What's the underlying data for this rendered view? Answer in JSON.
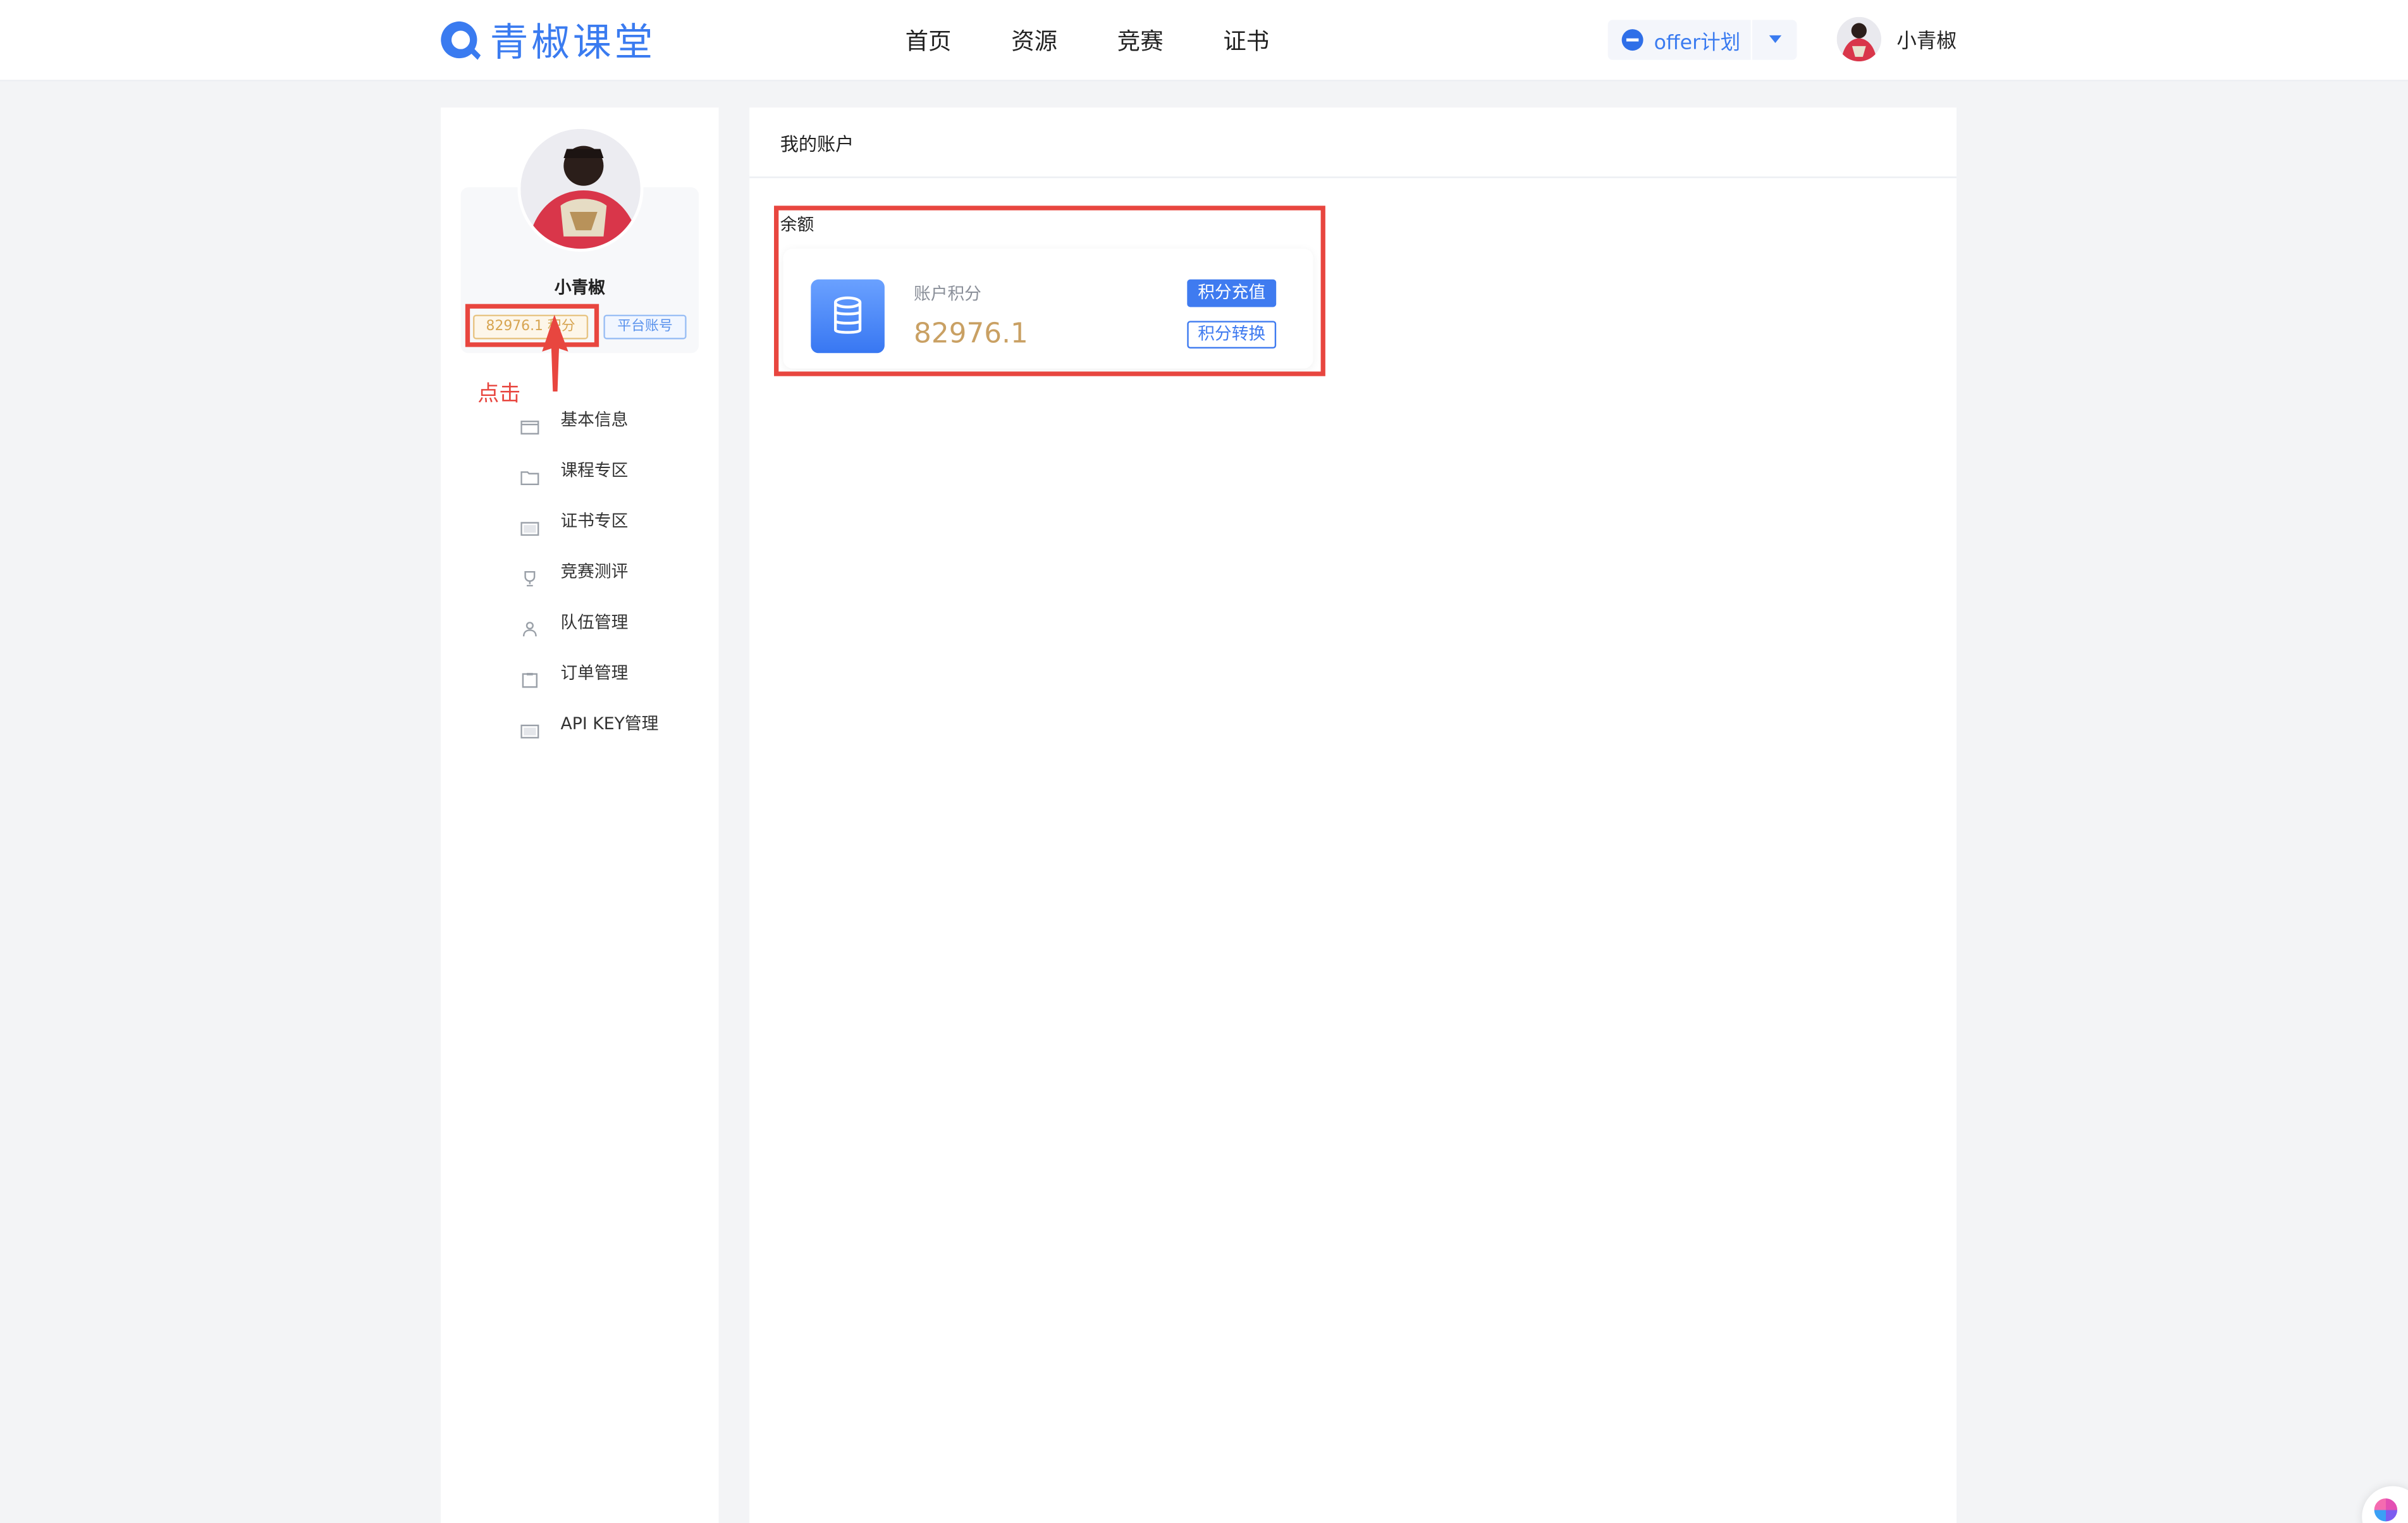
{
  "header": {
    "logo_text": "青椒课堂",
    "nav": [
      "首页",
      "资源",
      "竞赛",
      "证书"
    ],
    "plan_selector": {
      "label": "offer计划"
    },
    "user_name": "小青椒"
  },
  "sidebar": {
    "profile": {
      "name": "小青椒",
      "points_badge": "82976.1 积分",
      "platform_badge": "平台账号"
    },
    "menu": [
      {
        "label": "基本信息",
        "icon": "calendar-icon"
      },
      {
        "label": "课程专区",
        "icon": "folder-icon"
      },
      {
        "label": "证书专区",
        "icon": "certificate-icon"
      },
      {
        "label": "竞赛测评",
        "icon": "trophy-icon"
      },
      {
        "label": "队伍管理",
        "icon": "team-icon"
      },
      {
        "label": "订单管理",
        "icon": "clipboard-icon"
      },
      {
        "label": "API KEY管理",
        "icon": "key-card-icon"
      }
    ]
  },
  "main": {
    "title": "我的账户",
    "balance_label": "余额",
    "account_card": {
      "label": "账户积分",
      "value": "82976.1",
      "recharge_button": "积分充值",
      "transfer_button": "积分转换"
    }
  },
  "annotation": {
    "click_note": "点击"
  },
  "colors": {
    "brand_blue": "#3a7bf0",
    "points_gold": "#c9a063",
    "annotation_red": "#e8463f"
  }
}
